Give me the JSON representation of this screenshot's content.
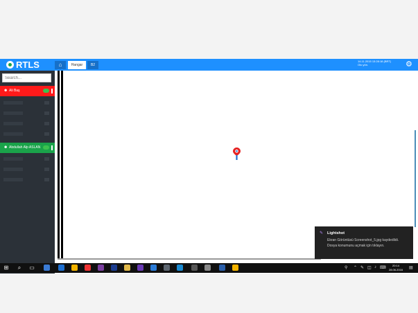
{
  "app": {
    "logo_text": "RTLS",
    "datetime_line1": "14.11.2015 13:28:18 (BRT)",
    "datetime_line2": "Oto yön."
  },
  "tabs": [
    {
      "label": "⌂"
    },
    {
      "label": "Hangar"
    },
    {
      "label": "B2"
    }
  ],
  "search": {
    "placeholder": "Search..."
  },
  "sidebar": {
    "groups": [
      {
        "name": "Ali Baş",
        "color": "#ff1a1a"
      },
      {
        "name": "Abdullah Alp ASLAN",
        "color": "#1aa34a"
      }
    ]
  },
  "toast": {
    "title": "Lightshot",
    "body": "Ekran Görüntüsü Screenshot_5.jpg kaydedildi. Dosya konumunu açmak için tıklayın."
  },
  "taskbar": {
    "time": "20:14",
    "date": "28.06.2016"
  },
  "colors": {
    "topbar": "#1e90ff",
    "sidebar": "#2b3138",
    "alert_red": "#ff1a1a",
    "ok_green": "#1aa34a"
  }
}
